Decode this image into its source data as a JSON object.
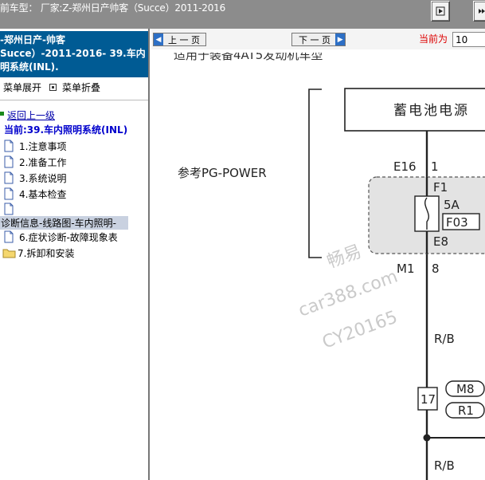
{
  "header": {
    "title": "前车型：  厂家:Z-郑州日产帅客（Succe）2011-2016"
  },
  "toolbar": {
    "buttons": [
      {
        "icon": "play-right-icon"
      },
      {
        "icon": "skip-end-icon"
      }
    ]
  },
  "sidebar": {
    "heading_lines": [
      "-郑州日产-帅客",
      "Succe）-2011-2016- 39.车内",
      "明系统(INL)."
    ],
    "expand_label": "菜单展开",
    "collapse_label": "菜单折叠",
    "back_label": "返回上一级",
    "current_label": "当前:39.车内照明系统(INL)",
    "items": [
      {
        "label": "1.注意事项",
        "icon": "page-icon"
      },
      {
        "label": "2.准备工作",
        "icon": "page-icon"
      },
      {
        "label": "3.系统说明",
        "icon": "page-icon"
      },
      {
        "label": "4.基本检查",
        "icon": "page-icon"
      },
      {
        "label": "",
        "icon": "page-icon"
      },
      {
        "label": "诊断信息-线路图-车内照明-",
        "icon": ""
      },
      {
        "label": "6.症状诊断-故障现象表",
        "icon": "page-icon"
      },
      {
        "label": "7.拆卸和安装",
        "icon": "folder-icon"
      }
    ]
  },
  "nav": {
    "prev_label": "上 一 页",
    "next_label": "下 一 页",
    "current_label": "当前为",
    "page_value": "10"
  },
  "diagram": {
    "top_text": "适用于装备4AT5发动机车型",
    "battery_label": "蓄电池电源",
    "ref_label": "参考PG-POWER",
    "e16": "E16",
    "pin1": "1",
    "f1": "F1",
    "fuse_rating": "5A",
    "f03": "F03",
    "e8": "E8",
    "m1": "M1",
    "pin8": "8",
    "wire1": "R/B",
    "wire2": "R/B",
    "conn17": "17",
    "m8": "M8",
    "r1": "R1",
    "watermark1": "畅易",
    "watermark2": "car388.com",
    "watermark3": "CY20165"
  }
}
